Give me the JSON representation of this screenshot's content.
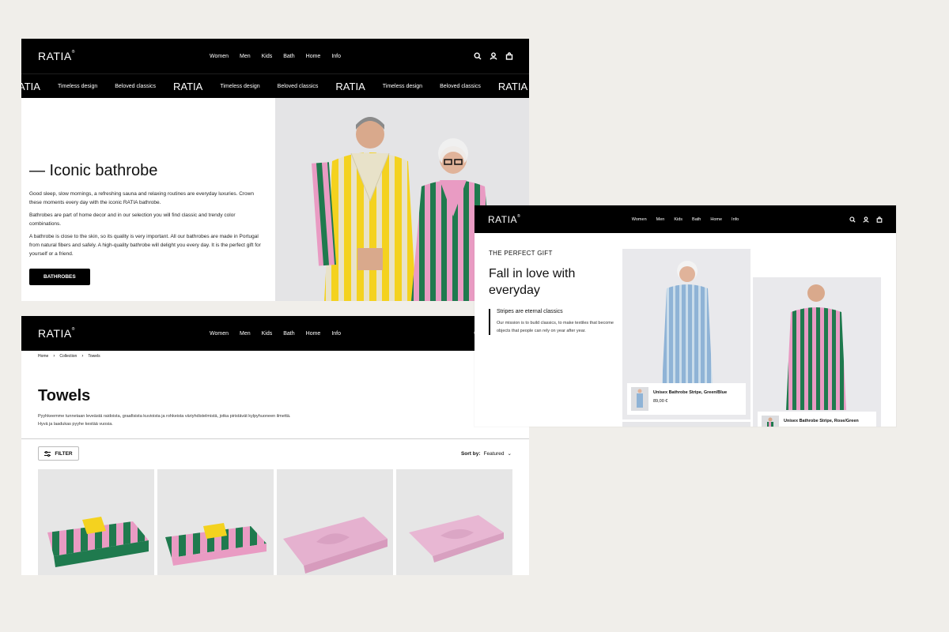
{
  "brand": "RATIA",
  "nav": [
    "Women",
    "Men",
    "Kids",
    "Bath",
    "Home",
    "Info"
  ],
  "marquee": [
    "ATIA",
    "Timeless design",
    "Beloved classics",
    "RATIA",
    "Timeless design",
    "Beloved classics",
    "RATIA",
    "Timeless design",
    "Beloved classics",
    "RATIA"
  ],
  "hero": {
    "title": "— Iconic bathrobe",
    "paragraphs": [
      "Good sleep, slow mornings, a refreshing sauna and relaxing routines are everyday luxuries. Crown these moments every day with the iconic RATIA bathrobe.",
      "Bathrobes are part of home decor and in our selection you will find classic and trendy color combinations.",
      "A bathrobe is close to the skin, so its quality is very important. All our bathrobes are made in Portugal from natural fibers and safely. A high-quality bathrobe will delight you every day. It is the perfect gift for yourself or a friend."
    ],
    "button": "BATHROBES"
  },
  "gift": {
    "eyebrow": "THE PERFECT GIFT",
    "title": "Fall in love with everyday",
    "subtitle": "Stripes are eternal classics",
    "body": "Our mission is to build classics, to make textiles that become objects that people can rely on year after year.",
    "products": [
      {
        "name": "Unisex Bathrobe Stripe, Green/Blue",
        "price": "89,00 €"
      },
      {
        "name": "Unisex Bathrobe Stripe, Rose/Green",
        "price": ""
      }
    ]
  },
  "collection": {
    "breadcrumb": [
      "Home",
      "Collection",
      "Towels"
    ],
    "title": "Towels",
    "description": "Pyyhkeemme tunnetaan leveästä raidoista, graafisista kuvioista ja rohkeista väriyhdistelmistä, jotka piristävät kylpyhuoneen ilmettä. Hyvä ja laadukas pyyhe kestää vuosia.",
    "filter_label": "FILTER",
    "sort_label": "Sort by:",
    "sort_value": "Featured"
  },
  "colors": {
    "background": "#f0eeea",
    "header": "#000000",
    "stripe_pink": "#e99bc3",
    "stripe_green": "#1f7a4e",
    "stripe_yellow": "#f4d21f"
  },
  "icons": [
    "search-icon",
    "user-icon",
    "cart-icon",
    "chevron-right-icon",
    "chevron-down-icon",
    "filter-icon"
  ]
}
